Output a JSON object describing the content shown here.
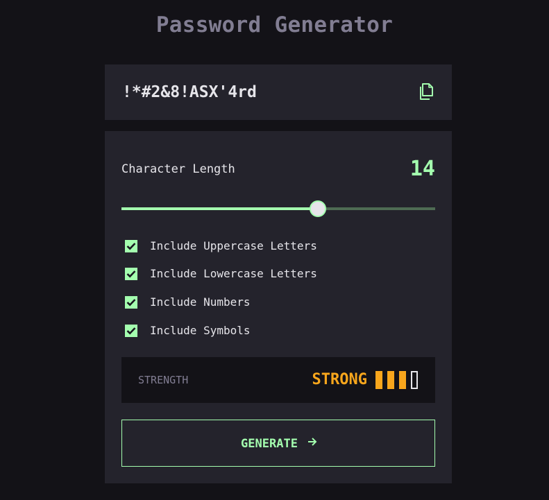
{
  "app": {
    "title": "Password Generator"
  },
  "output": {
    "password": "!*#2&8!ASX'4rd",
    "copy_icon": "copy-icon"
  },
  "length": {
    "label": "Character Length",
    "value": "14",
    "min": 0,
    "max": 22,
    "fill_fraction": 0.625
  },
  "options": [
    {
      "label": "Include Uppercase Letters",
      "checked": true
    },
    {
      "label": "Include Lowercase Letters",
      "checked": true
    },
    {
      "label": "Include Numbers",
      "checked": true
    },
    {
      "label": "Include Symbols",
      "checked": true
    }
  ],
  "strength": {
    "label": "STRENGTH",
    "value": "STRONG",
    "level": 3,
    "total_bars": 4
  },
  "generate": {
    "label": "GENERATE",
    "icon": "arrow-right-icon"
  },
  "colors": {
    "background": "#131217",
    "panel": "#24232C",
    "accent": "#A4FFAF",
    "muted": "#817D92",
    "text": "#E6E5EA",
    "strength_strong": "#F8A61C",
    "slider_track": "#4E6B53"
  }
}
